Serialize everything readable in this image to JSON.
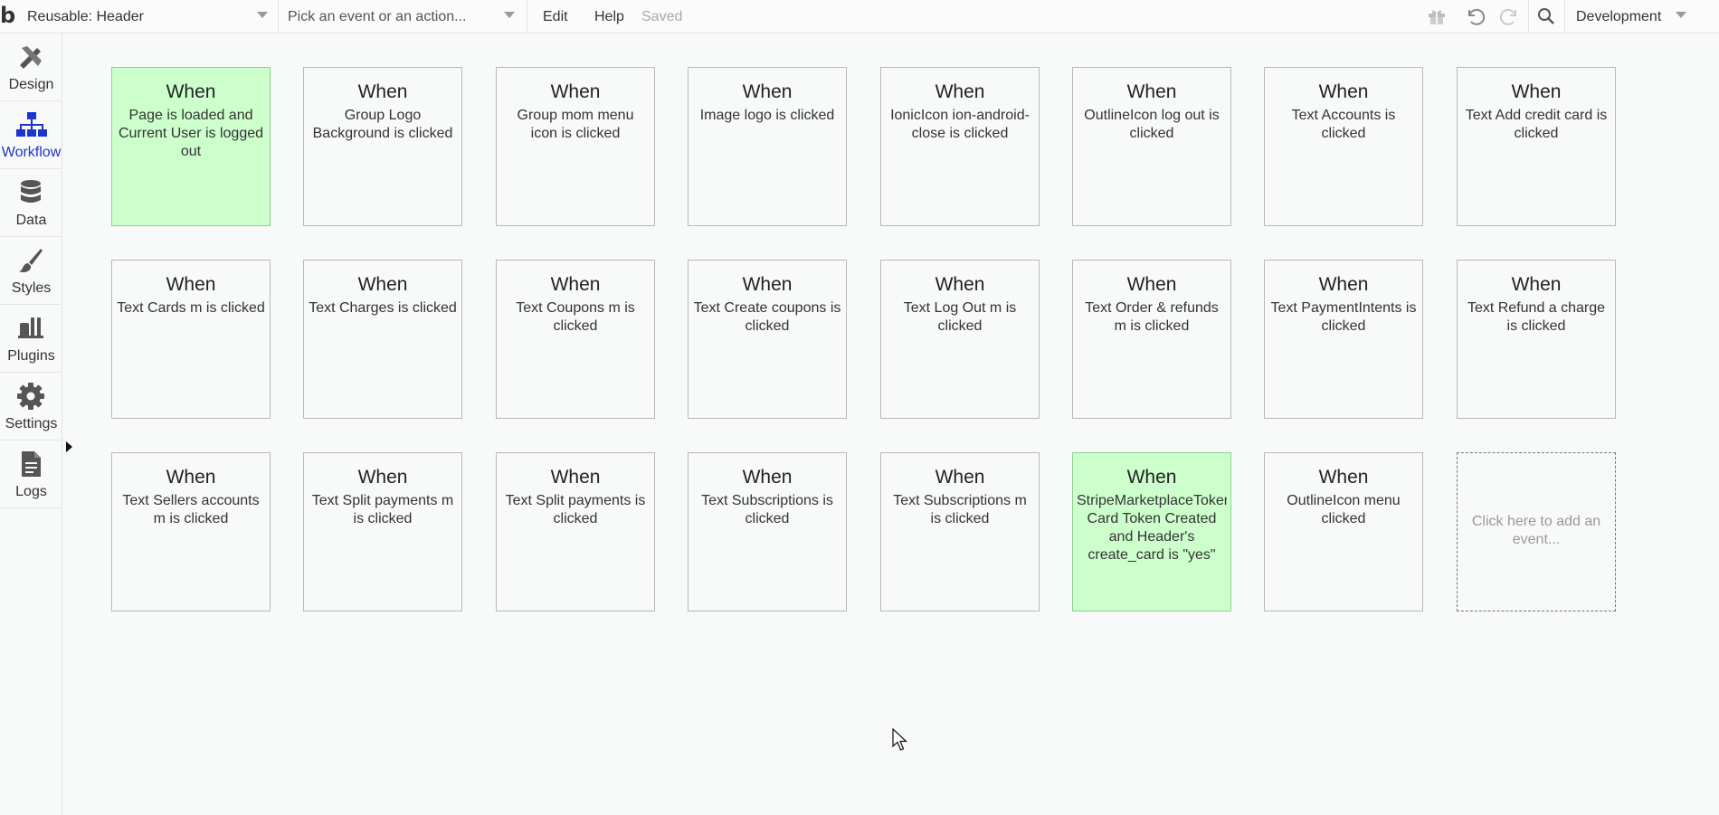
{
  "topbar": {
    "logo": "b",
    "page_selector": "Reusable: Header",
    "event_picker_placeholder": "Pick an event or an action...",
    "menu_edit": "Edit",
    "menu_help": "Help",
    "status": "Saved",
    "environment": "Development"
  },
  "sidebar": {
    "items": [
      {
        "label": "Design",
        "icon": "design-icon"
      },
      {
        "label": "Workflow",
        "icon": "workflow-icon"
      },
      {
        "label": "Data",
        "icon": "database-icon"
      },
      {
        "label": "Styles",
        "icon": "brush-icon"
      },
      {
        "label": "Plugins",
        "icon": "plug-icon"
      },
      {
        "label": "Settings",
        "icon": "gear-icon"
      },
      {
        "label": "Logs",
        "icon": "document-icon"
      }
    ],
    "active": "Workflow"
  },
  "events": [
    {
      "when": "When",
      "desc": "Page is loaded and\nCurrent User is logged\nout",
      "highlight": true
    },
    {
      "when": "When",
      "desc": "Group Logo\nBackground is clicked",
      "highlight": false
    },
    {
      "when": "When",
      "desc": "Group mom menu\nicon is clicked",
      "highlight": false
    },
    {
      "when": "When",
      "desc": "Image logo is clicked",
      "highlight": false
    },
    {
      "when": "When",
      "desc": "IonicIcon ion-android-\nclose is clicked",
      "highlight": false
    },
    {
      "when": "When",
      "desc": "OutlineIcon log out is\nclicked",
      "highlight": false
    },
    {
      "when": "When",
      "desc": "Text Accounts is\nclicked",
      "highlight": false
    },
    {
      "when": "When",
      "desc": "Text Add credit card is\nclicked",
      "highlight": false
    },
    {
      "when": "When",
      "desc": "Text Cards m is clicked",
      "highlight": false
    },
    {
      "when": "When",
      "desc": "Text Charges is clicked",
      "highlight": false
    },
    {
      "when": "When",
      "desc": "Text Coupons m is\nclicked",
      "highlight": false
    },
    {
      "when": "When",
      "desc": "Text Create coupons is\nclicked",
      "highlight": false
    },
    {
      "when": "When",
      "desc": "Text Log Out m is\nclicked",
      "highlight": false
    },
    {
      "when": "When",
      "desc": "Text Order & refunds\nm is clicked",
      "highlight": false
    },
    {
      "when": "When",
      "desc": "Text PaymentIntents is\nclicked",
      "highlight": false
    },
    {
      "when": "When",
      "desc": "Text Refund a charge\nis clicked",
      "highlight": false
    },
    {
      "when": "When",
      "desc": "Text Sellers accounts\nm is clicked",
      "highlight": false
    },
    {
      "when": "When",
      "desc": "Text Split payments m\nis clicked",
      "highlight": false
    },
    {
      "when": "When",
      "desc": "Text Split payments is\nclicked",
      "highlight": false
    },
    {
      "when": "When",
      "desc": "Text Subscriptions is\nclicked",
      "highlight": false
    },
    {
      "when": "When",
      "desc": "Text Subscriptions m\nis clicked",
      "highlight": false
    },
    {
      "when": "When",
      "desc": "StripeMarketplaceToker\nCard Token Created\nand Header's\ncreate_card is \"yes\"",
      "highlight": true
    },
    {
      "when": "When",
      "desc": "OutlineIcon menu\nclicked",
      "highlight": false
    }
  ],
  "add_event_label": "Click here to add an\nevent..."
}
